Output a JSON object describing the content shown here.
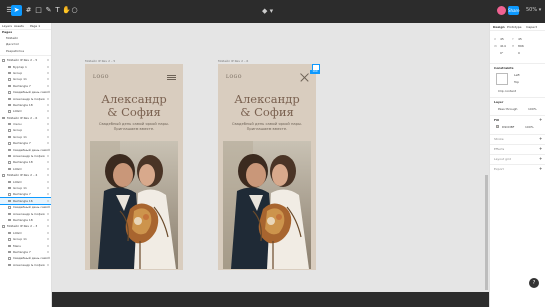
{
  "toolbar": {
    "center_label": "◆ ▾",
    "zoom": "50% ▾",
    "share_label": "Share"
  },
  "left_panel": {
    "tabs": [
      "Layers",
      "Assets",
      "Page 1"
    ],
    "pages_title": "Pages",
    "pages": [
      "Мобайл",
      "Десктоп",
      "Разработка"
    ],
    "layers": [
      {
        "label": "Мобайл IP Rev 2 – 5",
        "sel": false
      },
      {
        "label": "Бургер 1",
        "sel": false
      },
      {
        "label": "Group",
        "sel": false
      },
      {
        "label": "Group 11",
        "sel": false
      },
      {
        "label": "Rectangle 7",
        "sel": false
      },
      {
        "label": "Свадебный день самой яркой",
        "sel": false
      },
      {
        "label": "Александр & София",
        "sel": false
      },
      {
        "label": "Rectangle 18",
        "sel": false
      },
      {
        "label": "LOGO",
        "sel": false
      },
      {
        "label": "Мобайл IP Rev 2 – 6",
        "sel": false
      },
      {
        "label": "menu",
        "sel": false
      },
      {
        "label": "Group",
        "sel": false
      },
      {
        "label": "Group 11",
        "sel": false
      },
      {
        "label": "Rectangle 7",
        "sel": false
      },
      {
        "label": "Свадебный день самой яркой",
        "sel": false
      },
      {
        "label": "Александр & София",
        "sel": false
      },
      {
        "label": "Rectangle 18",
        "sel": false
      },
      {
        "label": "LOGO",
        "sel": false
      },
      {
        "label": "Мобайл IP Rev 2 – 4",
        "sel": false
      },
      {
        "label": "LOGO",
        "sel": false
      },
      {
        "label": "Group 11",
        "sel": false
      },
      {
        "label": "Rectangle 7",
        "sel": false
      },
      {
        "label": "Rectangle 16",
        "sel": true
      },
      {
        "label": "Свадебный день самой яркой",
        "sel": false
      },
      {
        "label": "Александр & София",
        "sel": false
      },
      {
        "label": "Rectangle 18",
        "sel": false
      },
      {
        "label": "Мобайл IP Rev 2 – 3",
        "sel": false
      },
      {
        "label": "LOGO",
        "sel": false
      },
      {
        "label": "Group 11",
        "sel": false
      },
      {
        "label": "Menu",
        "sel": false
      },
      {
        "label": "Rectangle 7",
        "sel": false
      },
      {
        "label": "Свадебный день самой яркой",
        "sel": false
      },
      {
        "label": "Александр & София",
        "sel": false
      }
    ]
  },
  "frames": [
    {
      "label": "Мобайл IP Rev 2 – 5",
      "logo": "LOGO",
      "names": "Александр & София",
      "name1": "Александр",
      "name2": "& София",
      "subtitle": "Свадебный день самой яркой пары. Приглашаем вместе.",
      "menu_type": "burger-icon"
    },
    {
      "label": "Мобайл IP Rev 2 – 6",
      "logo": "LOGO",
      "names": "Александр & София",
      "name1": "Александр",
      "name2": "& София",
      "subtitle": "Свадебный день самой яркой пары. Приглашаем вместе.",
      "menu_type": "close-icon"
    }
  ],
  "right_panel": {
    "tabs": [
      "Design",
      "Prototype",
      "Inspect"
    ],
    "x": "45",
    "y": "45",
    "w": "414",
    "h": "896",
    "rotation": "0°",
    "radius": "0",
    "constraints_title": "Constraints",
    "constraint_left": "Left",
    "constraint_top": "Top",
    "clip_label": "Clip content",
    "layer_title": "Layer",
    "blend": "Pass through",
    "opacity": "100%",
    "fill_title": "Fill",
    "fill_hex": "D9CDBF",
    "fill_opacity": "100%",
    "stroke_title": "Stroke",
    "effects_title": "Effects",
    "grid_title": "Layout grid",
    "export_title": "Export",
    "fill_color": "#d9cdbf"
  },
  "badge_text": "160"
}
